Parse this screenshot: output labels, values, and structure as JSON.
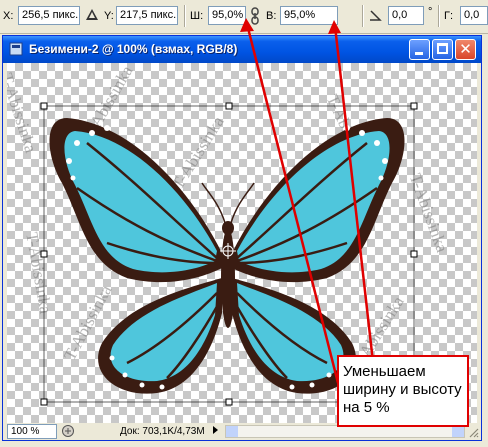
{
  "options_bar": {
    "x_label": "X:",
    "x_value": "256,5 пикс.",
    "y_label": "Y:",
    "y_value": "217,5 пикс.",
    "w_label": "Ш:",
    "w_value": "95,0%",
    "h_label": "В:",
    "h_value": "95,0%",
    "angle_value": "0,0",
    "angle_unit": "°",
    "g_label": "Г:",
    "g_value": "0,0"
  },
  "window": {
    "title": "Безимени-2 @ 100% (взмах, RGB/8)"
  },
  "watermark": "T-Abissinka",
  "status": {
    "zoom": "100 %",
    "doc_info": "Док: 703,1K/4,73M"
  },
  "annotation": {
    "text": "Уменьшаем ширину и высоту на 5 %",
    "color": "#e00000"
  },
  "butterfly_colors": {
    "wing": "#4fc6dc",
    "outline": "#3a1c12",
    "spots": "#ffffff"
  }
}
